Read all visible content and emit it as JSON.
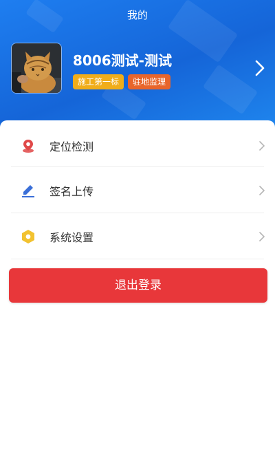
{
  "header": {
    "title": "我的",
    "background": "#1e7ef0"
  },
  "profile": {
    "name": "8006测试-测试",
    "avatar_icon": "cat-photo-avatar",
    "badges": [
      {
        "label": "施工第一标",
        "color": "#f0ad1a"
      },
      {
        "label": "驻地监理",
        "color": "#e8652b"
      }
    ],
    "arrow_icon": "chevron-right-icon"
  },
  "menu": {
    "items": [
      {
        "label": "定位检测",
        "icon": "location-pin-icon",
        "icon_color": "#e04848"
      },
      {
        "label": "签名上传",
        "icon": "pen-icon",
        "icon_color": "#3a6fd8"
      },
      {
        "label": "系统设置",
        "icon": "hexagon-settings-icon",
        "icon_color": "#f2c230"
      }
    ]
  },
  "logout": {
    "label": "退出登录",
    "color": "#e8373a"
  }
}
